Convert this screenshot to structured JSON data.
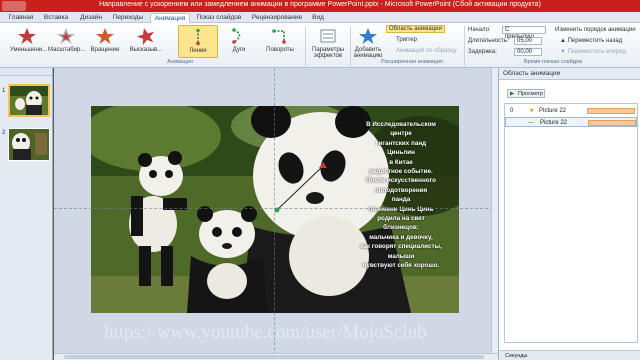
{
  "window": {
    "title": "Направление с ускорением или замедлением анимации в программе PowerPoint.pptx - Microsoft PowerPoint (Сбой активации продукта)"
  },
  "tabs": [
    "Главная",
    "Вставка",
    "Дизайн",
    "Переходы",
    "Анимация",
    "Показ слайдов",
    "Рецензирование",
    "Вид"
  ],
  "ribbon": {
    "effects": [
      "Уменьшени...",
      "Масштабир...",
      "Вращение",
      "Высказыв...",
      "Линии",
      "Дуги",
      "Повороты"
    ],
    "effect_params": "Параметры эффектов",
    "add_animation": "Добавить анимацию",
    "animation_pane": "Область анимации",
    "trigger": "Триггер",
    "painter": "Анимация по образцу",
    "start_label": "Начало:",
    "start_value": "С предыдущ...",
    "duration_label": "Длительность:",
    "duration_value": "05,00",
    "delay_label": "Задержка:",
    "delay_value": "00,00",
    "reorder_title": "Изменить порядок анимации",
    "move_back": "Переместить назад",
    "move_forward": "Переместить вперед",
    "group_animation": "Анимация",
    "group_advanced": "Расширенная анимация",
    "group_timing": "Время показа слайдов"
  },
  "slides": {
    "numbers": [
      "1",
      "2"
    ]
  },
  "slide": {
    "lines": [
      "В Исследовательском",
      "центре",
      "гигантских панд",
      "Циньлин",
      "в Китае",
      "радостное событие.",
      "После искусственного",
      "оплодотворения",
      "панда",
      "по имени Цинь Цинь",
      "родила на свет",
      "близнецов:",
      "мальчика и девочку,",
      "как говорят специалисты,",
      "малыши",
      "чувствуют себя хорошо."
    ]
  },
  "animpane": {
    "title": "Область анимации",
    "play": "Просмотр",
    "items": [
      {
        "num": "0",
        "name": "Picture 22"
      },
      {
        "num": "",
        "name": "Picture 22"
      }
    ],
    "seconds": "Секунды"
  },
  "watermark": "https://www.youtube.com/user/MojoSclub",
  "colors": {
    "title_bar": "#c8201a",
    "ribbon_bg": "#e8eef5",
    "selected": "#fde48e"
  }
}
